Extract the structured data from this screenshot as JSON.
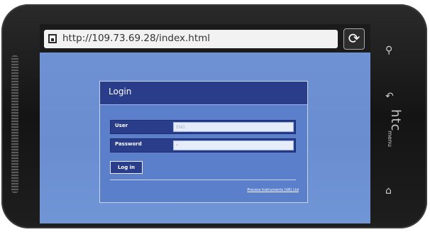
{
  "device": {
    "brand": "htc"
  },
  "browser": {
    "url": "http://109.73.69.28/index.html",
    "refresh_icon": "refresh-icon",
    "page_icon": "page-icon"
  },
  "login": {
    "title": "Login",
    "user_label": "User",
    "user_value": "ENG",
    "password_label": "Password",
    "password_value": "*",
    "button_label": "Log in",
    "footer_link": "Process Instruments (UK) Ltd"
  },
  "hardware_buttons": [
    {
      "name": "search-icon",
      "symbol": "⚲"
    },
    {
      "name": "back-icon",
      "symbol": "↶"
    },
    {
      "name": "menu-button",
      "symbol": "menu"
    },
    {
      "name": "home-icon",
      "symbol": "⌂"
    }
  ],
  "colors": {
    "screen_bg": "#6f93d4",
    "panel_header": "#2a3d8a",
    "panel_bg": "#5b7fcb"
  }
}
